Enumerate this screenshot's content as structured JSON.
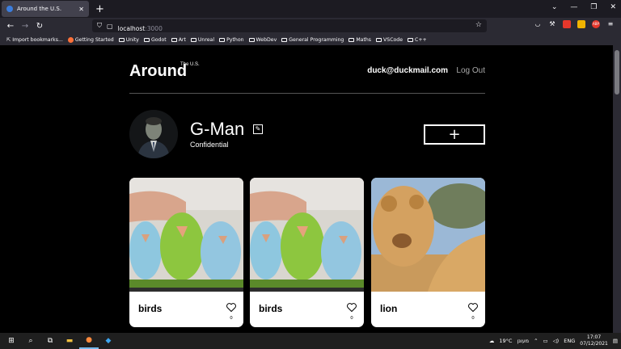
{
  "browser": {
    "tab_title": "Around the U.S.",
    "url_host": "localhost",
    "url_port": ":3000",
    "bookmarks": [
      "Import bookmarks...",
      "Getting Started",
      "Unity",
      "Godot",
      "Art",
      "Unreal",
      "Python",
      "WebDev",
      "General Programming",
      "Maths",
      "VSCode",
      "C++"
    ]
  },
  "header": {
    "logo": "Around",
    "logo_sup": "The U.S.",
    "email": "duck@duckmail.com",
    "logout": "Log Out"
  },
  "profile": {
    "name": "G-Man",
    "about": "Confidential",
    "add_label": "+"
  },
  "cards": [
    {
      "title": "birds",
      "likes": "0"
    },
    {
      "title": "birds",
      "likes": "0"
    },
    {
      "title": "lion",
      "likes": "0"
    }
  ],
  "taskbar": {
    "weather": "19°C",
    "weather_label": "מעונן",
    "lang": "ENG",
    "time": "17:07",
    "date": "07/12/2021"
  },
  "colors": {
    "accent": "#76b9ed",
    "chrome_dark": "#1c1b22",
    "chrome": "#2b2a33"
  }
}
